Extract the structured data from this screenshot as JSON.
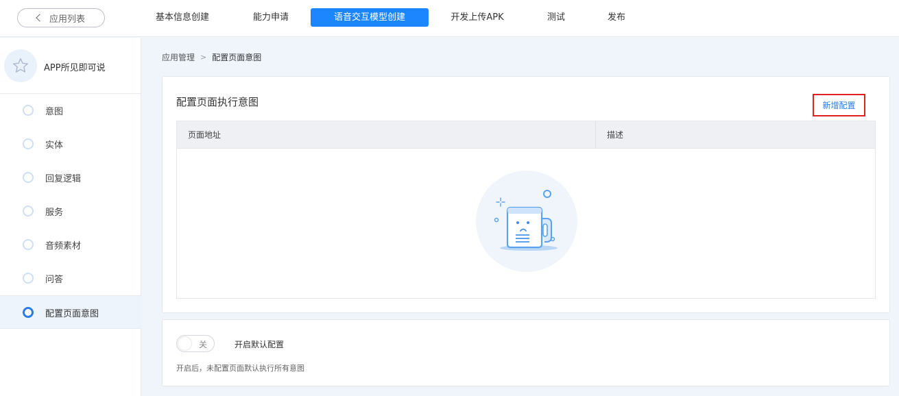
{
  "topbar": {
    "back_label": "应用列表",
    "steps": [
      {
        "label": "基本信息创建",
        "active": false
      },
      {
        "label": "能力申请",
        "active": false
      },
      {
        "label": "语音交互模型创建",
        "active": true
      },
      {
        "label": "开发上传APK",
        "active": false
      },
      {
        "label": "测试",
        "active": false
      },
      {
        "label": "发布",
        "active": false
      }
    ]
  },
  "sidebar": {
    "app_name": "APP所见即可说",
    "items": [
      {
        "label": "意图"
      },
      {
        "label": "实体"
      },
      {
        "label": "回复逻辑"
      },
      {
        "label": "服务"
      },
      {
        "label": "音频素材"
      },
      {
        "label": "问答"
      },
      {
        "label": "配置页面意图",
        "active": true
      }
    ]
  },
  "breadcrumb": {
    "parent": "应用管理",
    "separator": ">",
    "current": "配置页面意图"
  },
  "intent_card": {
    "title": "配置页面执行意图",
    "add_button": "新增配置",
    "columns": [
      "页面地址",
      "描述"
    ],
    "rows": []
  },
  "default_card": {
    "toggle_state": "关",
    "toggle_label": "开启默认配置",
    "hint": "开启后，未配置页面默认执行所有意图"
  },
  "colors": {
    "primary": "#1b86ff",
    "highlight_border": "#e0201c",
    "page_bg": "#f0f5fb"
  }
}
